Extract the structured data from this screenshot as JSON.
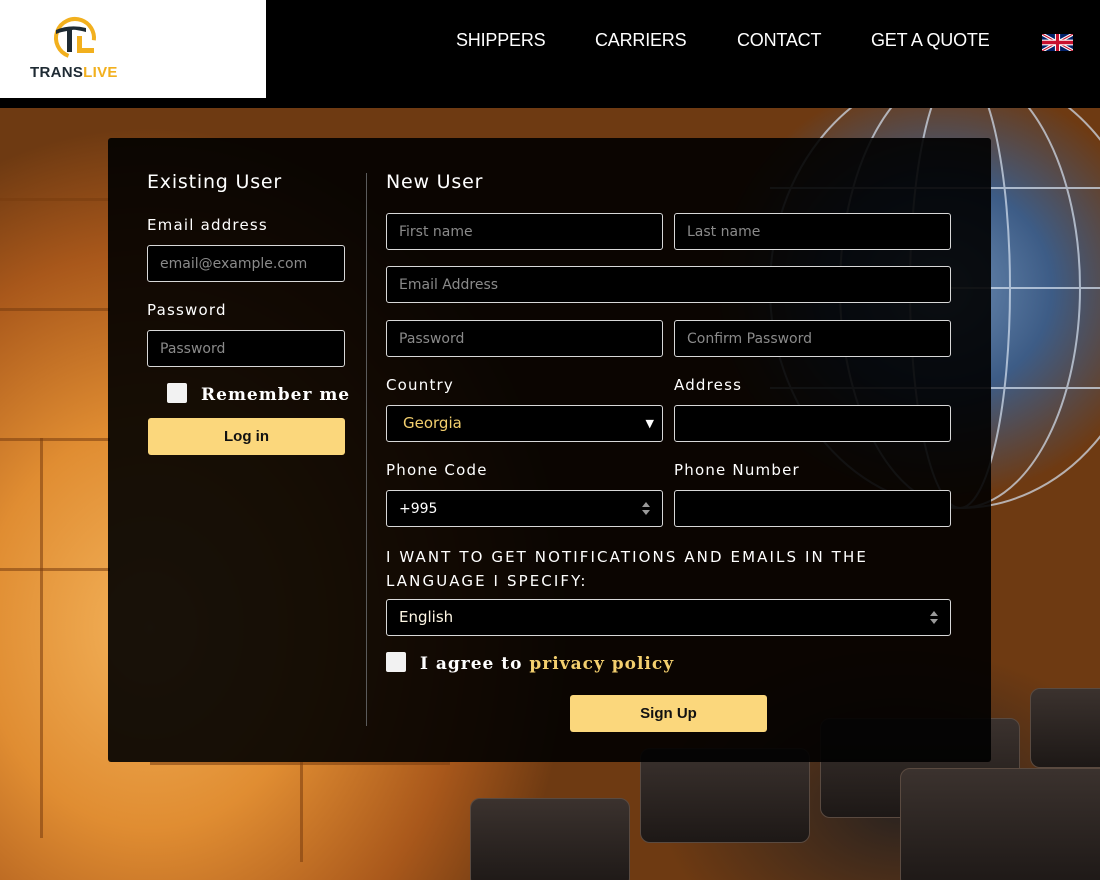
{
  "brand": {
    "name_part1": "TRANS",
    "name_part2": "LIVE",
    "accent": "#f2b01e"
  },
  "nav": {
    "items": [
      "SHIPPERS",
      "CARRIERS",
      "CONTACT",
      "GET A QUOTE"
    ],
    "language_flag": "uk-flag-icon"
  },
  "existing_user": {
    "title": "Existing User",
    "email_label": "Email address",
    "email_placeholder": "email@example.com",
    "password_label": "Password",
    "password_placeholder": "Password",
    "remember_label": "Remember me",
    "login_button": "Log in"
  },
  "new_user": {
    "title": "New User",
    "first_name_placeholder": "First name",
    "last_name_placeholder": "Last name",
    "email_placeholder": "Email Address",
    "password_placeholder": "Password",
    "confirm_password_placeholder": "Confirm Password",
    "country_label": "Country",
    "country_value": "Georgia",
    "address_label": "Address",
    "address_value": "",
    "phone_code_label": "Phone Code",
    "phone_code_value": "+995",
    "phone_number_label": "Phone Number",
    "phone_number_value": "",
    "notification_text": "I WANT TO GET NOTIFICATIONS AND EMAILS IN THE LANGUAGE I SPECIFY:",
    "language_value": "English",
    "agree_prefix": "I agree to",
    "agree_link": "privacy policy",
    "signup_button": "Sign Up"
  },
  "colors": {
    "button": "#fbd77c",
    "link": "#f3cf6e",
    "panel": "#000000"
  }
}
